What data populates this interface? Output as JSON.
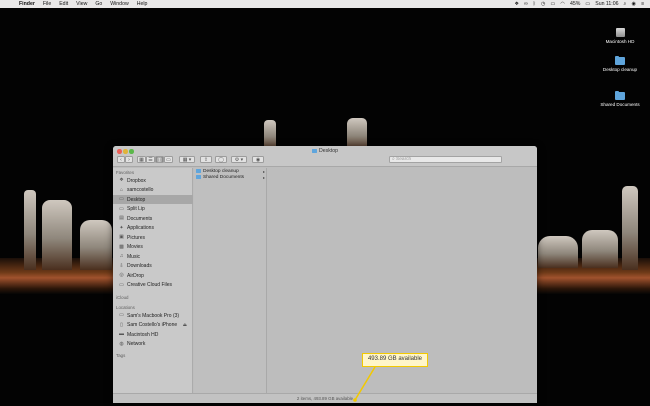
{
  "menubar": {
    "apple_glyph": "",
    "app_name": "Finder",
    "menus": [
      "File",
      "Edit",
      "View",
      "Go",
      "Window",
      "Help"
    ],
    "status": {
      "battery": "45%",
      "clock": "Sun 11:06"
    }
  },
  "desktop_icons": [
    {
      "label": "Macintosh HD",
      "icon": "hard-drive-icon"
    },
    {
      "label": "Desktop cleanup",
      "icon": "folder-icon"
    },
    {
      "label": "Shared Documents",
      "icon": "folder-icon"
    }
  ],
  "window": {
    "title": "Desktop",
    "search_placeholder": "Search",
    "status_text": "2 items, 493.89 GB available"
  },
  "sidebar": {
    "favorites_header": "Favorites",
    "favorites": [
      {
        "label": "Dropbox",
        "icon": "dropbox-icon"
      },
      {
        "label": "samcostello",
        "icon": "home-icon"
      },
      {
        "label": "Desktop",
        "icon": "desktop-icon",
        "selected": true
      },
      {
        "label": "Split Lip",
        "icon": "folder-icon"
      },
      {
        "label": "Documents",
        "icon": "documents-icon"
      },
      {
        "label": "Applications",
        "icon": "applications-icon"
      },
      {
        "label": "Pictures",
        "icon": "pictures-icon"
      },
      {
        "label": "Movies",
        "icon": "movies-icon"
      },
      {
        "label": "Music",
        "icon": "music-icon"
      },
      {
        "label": "Downloads",
        "icon": "downloads-icon"
      },
      {
        "label": "AirDrop",
        "icon": "airdrop-icon"
      },
      {
        "label": "Creative Cloud Files",
        "icon": "folder-icon"
      }
    ],
    "icloud_header": "iCloud",
    "locations_header": "Locations",
    "locations": [
      {
        "label": "Sam's Macbook Pro (3)",
        "icon": "laptop-icon"
      },
      {
        "label": "Sam Costello's iPhone",
        "icon": "iphone-icon",
        "eject": "⏏"
      },
      {
        "label": "Macintosh HD",
        "icon": "hard-drive-icon"
      },
      {
        "label": "Network",
        "icon": "network-icon"
      }
    ],
    "tags_header": "Tags"
  },
  "column1_items": [
    {
      "label": "Desktop cleanup",
      "arrow": "▸"
    },
    {
      "label": "Shared Documents",
      "arrow": "▸"
    }
  ],
  "callout": {
    "text": "493.89 GB available",
    "border_color": "#f2c900",
    "fill_color": "#fff6c9"
  }
}
